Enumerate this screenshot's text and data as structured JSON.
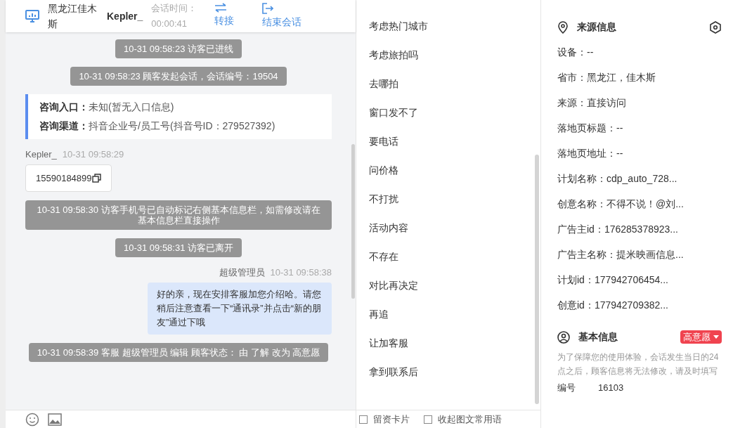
{
  "header": {
    "name": "黑龙江佳木斯",
    "agent": "Kepler_",
    "timer_label": "会话时间：",
    "timer": "00:00:41",
    "actions": [
      {
        "label": "转接",
        "kind": "transfer"
      },
      {
        "label": "结束会话",
        "kind": "end"
      }
    ]
  },
  "messages": [
    {
      "kind": "system",
      "text": "10-31 09:58:23 访客已进线"
    },
    {
      "kind": "system",
      "text": "10-31 09:58:23 顾客发起会话，会话编号：19504"
    },
    {
      "kind": "info",
      "rows": [
        {
          "label": "咨询入口：",
          "value": "未知(暂无入口信息)"
        },
        {
          "label": "咨询渠道：",
          "value": "抖音企业号/员工号(抖音号ID：279527392)"
        }
      ]
    },
    {
      "kind": "visitor",
      "sender": "Kepler_",
      "time": "10-31 09:58:29",
      "text": "15590184899"
    },
    {
      "kind": "system",
      "text": "10-31 09:58:30 访客手机号已自动标记右侧基本信息栏，如需修改请在基本信息栏直接操作"
    },
    {
      "kind": "system",
      "text": "10-31 09:58:31 访客已离开"
    },
    {
      "kind": "agent",
      "sender": "超级管理员",
      "time": "10-31 09:58:38",
      "text": "好的亲，现在安排客服加您介绍哈。请您稍后注意查看一下“通讯录”并点击“新的朋友”通过下哦"
    },
    {
      "kind": "system",
      "text": "10-31 09:58:39 客服 超级管理员 编辑 顾客状态： 由 了解 改为 高意愿"
    }
  ],
  "phrases": [
    "考虑热门城市",
    "考虑旅拍吗",
    "去哪拍",
    "窗口发不了",
    "要电话",
    "问价格",
    "不打扰",
    "活动内容",
    "不存在",
    "对比再决定",
    "再追",
    "让加客服",
    "拿到联系后"
  ],
  "bottom_tools": [
    "留资卡片",
    "收起图文常用语"
  ],
  "source_info": {
    "title": "来源信息",
    "items": [
      "设备：--",
      "省市：黑龙江，佳木斯",
      "来源：直接访问",
      "落地页标题：--",
      "落地页地址：--",
      "计划名称：cdp_auto_728...",
      "创意名称：不得不说！@刘...",
      "广告主id：176285378923...",
      "广告主名称：提米映画信息...",
      "计划id：177942706454...",
      "创意id：177942709382..."
    ]
  },
  "basic_info": {
    "title": "基本信息",
    "tag": "高意愿",
    "note": "为了保障您的使用体验，会话发生当日的24点之后，顾客信息将无法修改，请及时填写",
    "fields": [
      {
        "label": "编号",
        "value": "16103"
      }
    ]
  }
}
